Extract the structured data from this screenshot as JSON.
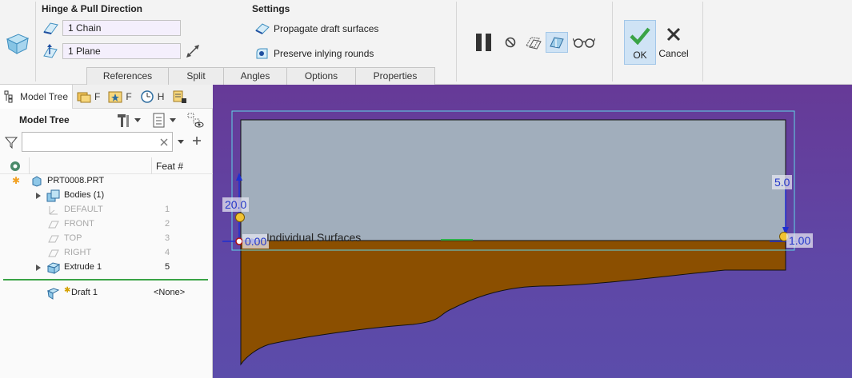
{
  "ribbon": {
    "hinge_group": {
      "title": "Hinge & Pull Direction",
      "hinge_collector": "1 Chain",
      "pull_collector": "1 Plane"
    },
    "settings_group": {
      "title": "Settings",
      "propagate_label": "Propagate draft surfaces",
      "preserve_label": "Preserve inlying rounds"
    },
    "tabs": [
      "References",
      "Split",
      "Angles",
      "Options",
      "Properties"
    ],
    "ok_label": "OK",
    "cancel_label": "Cancel"
  },
  "left_panel": {
    "tabs": [
      {
        "label": "Model Tree",
        "icon": "model-tree-icon"
      },
      {
        "label": "F",
        "icon": "folder-browser-icon"
      },
      {
        "label": "F",
        "icon": "favorites-icon"
      },
      {
        "label": "H",
        "icon": "history-icon"
      },
      {
        "label": "",
        "icon": "layer-icon"
      }
    ],
    "header_title": "Model Tree",
    "search_placeholder": "",
    "column_header": "Feat #",
    "items": [
      {
        "label": "PRT0008.PRT",
        "num": "",
        "dimmed": false
      },
      {
        "label": "Bodies (1)",
        "num": "",
        "dimmed": false
      },
      {
        "label": "DEFAULT",
        "num": "1",
        "dimmed": true
      },
      {
        "label": "FRONT",
        "num": "2",
        "dimmed": true
      },
      {
        "label": "TOP",
        "num": "3",
        "dimmed": true
      },
      {
        "label": "RIGHT",
        "num": "4",
        "dimmed": true
      },
      {
        "label": "Extrude 1",
        "num": "5",
        "dimmed": false
      },
      {
        "label": "Draft 1",
        "num": "<None>",
        "dimmed": false
      }
    ]
  },
  "graphics": {
    "dim_left_angle": "20.0",
    "dim_left_zero": "0.00",
    "dim_right_angle": "5.0",
    "dim_right_value": "1.00",
    "overlay_text": "Individual Surfaces"
  },
  "colors": {
    "background_purple": "#5f47a6",
    "top_face": "#a1aebc",
    "body_brown": "#8b4f00",
    "selection_cyan": "#5fd6e6",
    "ok_green": "#3aa346",
    "dimension_blue": "#2437c9"
  }
}
